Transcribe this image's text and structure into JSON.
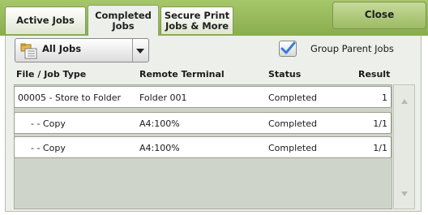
{
  "tabs": {
    "active_jobs": "Active Jobs",
    "completed_jobs_line1": "Completed",
    "completed_jobs_line2": "Jobs",
    "secure_print_line1": "Secure Print",
    "secure_print_line2": "Jobs & More"
  },
  "close_label": "Close",
  "filter": {
    "selected": "All Jobs",
    "icon": "folder-list-icon"
  },
  "group_parent_jobs": {
    "label": "Group Parent Jobs",
    "checked": true
  },
  "table": {
    "headers": {
      "type": "File / Job Type",
      "terminal": "Remote Terminal",
      "status": "Status",
      "result": "Result"
    },
    "rows": [
      {
        "type": "00005 - Store to Folder",
        "terminal": "Folder 001",
        "status": "Completed",
        "result": "1"
      },
      {
        "type": "-     - Copy",
        "terminal": "A4:100%",
        "status": "Completed",
        "result": "1/1"
      },
      {
        "type": "-     - Copy",
        "terminal": "A4:100%",
        "status": "Completed",
        "result": "1/1"
      }
    ]
  },
  "colors": {
    "topbar": "#98b95b",
    "checkmark": "#3a7bd5",
    "panel": "#ecefea"
  }
}
